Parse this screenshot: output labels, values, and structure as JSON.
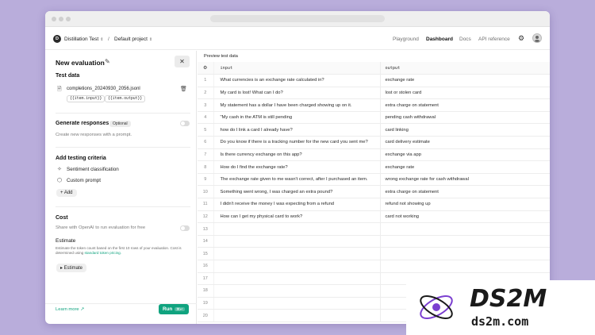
{
  "nav": {
    "project_initial": "D",
    "project_name": "Distillation Test",
    "separator": "/",
    "scope": "Default project",
    "links": [
      "Playground",
      "Dashboard",
      "Docs",
      "API reference"
    ],
    "active_link": "Dashboard"
  },
  "panel": {
    "title": "New evaluation",
    "test_data_heading": "Test data",
    "file_name": "completions_20240930_2056.jsonl",
    "chips": [
      "{{item.input}}",
      "{{item.output}}"
    ],
    "generate_heading": "Generate responses",
    "generate_badge": "Optional",
    "generate_desc": "Create new responses with a prompt.",
    "criteria_heading": "Add testing criteria",
    "criteria": [
      "Sentiment classification",
      "Custom prompt"
    ],
    "add_label": "+ Add",
    "cost_heading": "Cost",
    "share_label": "Share with OpenAI to run evaluation for free",
    "estimate_heading": "Estimate",
    "estimate_text": "Estimate the token count based on the first 10 rows of your evaluation. Cost is determined using",
    "estimate_link": "standard token pricing.",
    "estimate_button": "▸ Estimate",
    "learn_more": "Learn more ↗",
    "run_label": "Run",
    "run_shortcut": "⌘↵"
  },
  "preview": {
    "label": "Preview test data",
    "columns": [
      "input",
      "output"
    ],
    "rows": [
      {
        "n": "1",
        "input": "What currencies is an exchange rate calculated in?",
        "output": "exchange rate"
      },
      {
        "n": "2",
        "input": "My card is lost! What can I do?",
        "output": "lost or stolen card"
      },
      {
        "n": "3",
        "input": "My statement has a dollar I have been charged showing up on it.",
        "output": "extra charge on statement"
      },
      {
        "n": "4",
        "input": "\"My cash in the ATM is still pending",
        "output": "pending cash withdrawal"
      },
      {
        "n": "5",
        "input": "how do I link a card I already have?",
        "output": "card linking"
      },
      {
        "n": "6",
        "input": "Do you know if there is a tracking number for the new card you sent me?",
        "output": "card delivery estimate"
      },
      {
        "n": "7",
        "input": "Is there currency exchange on this app?",
        "output": "exchange via app"
      },
      {
        "n": "8",
        "input": "How do I find the exchange rate?",
        "output": "exchange rate"
      },
      {
        "n": "9",
        "input": "The exchange rate given to me wasn't correct, after I purchased an item.",
        "output": "wrong exchange rate for cash withdrawal"
      },
      {
        "n": "10",
        "input": "Something went wrong, I was charged an extra pound?",
        "output": "extra charge on statement"
      },
      {
        "n": "11",
        "input": "I didn't receive the money I was expecting from a refund",
        "output": "refund not showing up"
      },
      {
        "n": "12",
        "input": "How can I get my physical card to work?",
        "output": "card not working"
      },
      {
        "n": "13",
        "input": "",
        "output": ""
      },
      {
        "n": "14",
        "input": "",
        "output": ""
      },
      {
        "n": "15",
        "input": "",
        "output": ""
      },
      {
        "n": "16",
        "input": "",
        "output": ""
      },
      {
        "n": "17",
        "input": "",
        "output": ""
      },
      {
        "n": "18",
        "input": "",
        "output": ""
      },
      {
        "n": "19",
        "input": "",
        "output": ""
      },
      {
        "n": "20",
        "input": "",
        "output": ""
      }
    ]
  },
  "watermark": {
    "brand": "DS2M",
    "domain": "ds2m.com",
    "color": "#1a1a1a",
    "accent": "#7b3fd0"
  },
  "colors": {
    "accent": "#10a37f",
    "background": "#b9addb"
  }
}
